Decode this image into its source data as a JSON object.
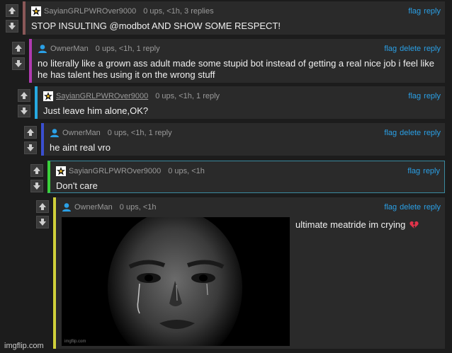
{
  "comments": [
    {
      "user": "SayianGRLPWROver9000",
      "stats": "0 ups, <1h, 3 replies",
      "actions": [
        "flag",
        "reply"
      ],
      "text": "STOP INSULTING @modbot AND SHOW SOME RESPECT!",
      "accent": "#8a5858"
    },
    {
      "user": "OwnerMan",
      "stats": "0 ups, <1h, 1 reply",
      "actions": [
        "flag",
        "delete",
        "reply"
      ],
      "text": "no literally like a grown ass adult made some stupid bot instead of getting a real nice job i feel like he has talent hes using it on the wrong stuff",
      "accent": "#b03ab0"
    },
    {
      "user": "SayianGRLPWROver9000",
      "stats": "0 ups, <1h, 1 reply",
      "actions": [
        "flag",
        "reply"
      ],
      "text": "Just leave him alone,OK?",
      "accent": "#26a9e0"
    },
    {
      "user": "OwnerMan",
      "stats": "0 ups, <1h, 1 reply",
      "actions": [
        "flag",
        "delete",
        "reply"
      ],
      "text": "he aint real vro",
      "accent": "#3a4fd0"
    },
    {
      "user": "SayianGRLPWROver9000",
      "stats": "0 ups, <1h",
      "actions": [
        "flag",
        "reply"
      ],
      "text": "Don't care",
      "accent": "#3ad03a"
    },
    {
      "user": "OwnerMan",
      "stats": "0 ups, <1h",
      "actions": [
        "flag",
        "delete",
        "reply"
      ],
      "text": "ultimate meatride im crying",
      "accent": "#d0d03a",
      "image_watermark": "imgflip.com"
    }
  ],
  "footer": {
    "watermark": "imgflip.com"
  },
  "colors": {
    "link": "#2aa0e6",
    "background": "#1c1c1c",
    "panel": "#2a2a2a"
  }
}
